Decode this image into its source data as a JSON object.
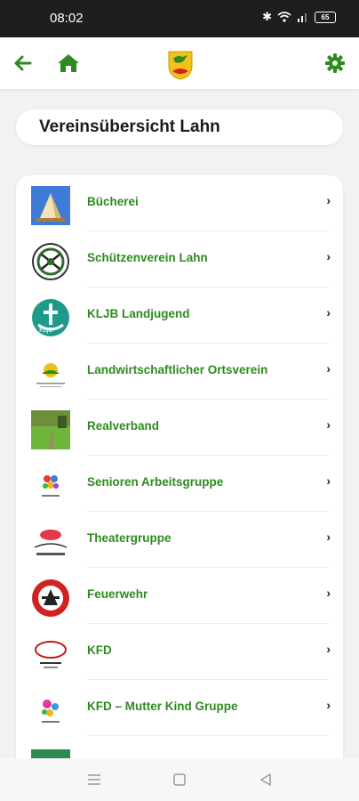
{
  "status_bar": {
    "time": "08:02",
    "battery": "65"
  },
  "app_bar": {
    "back_icon": "arrow-left-icon",
    "home_icon": "home-icon",
    "logo": "coat-of-arms-logo",
    "settings_icon": "gear-icon",
    "accent_color": "#2e8b1f"
  },
  "page": {
    "title": "Vereinsübersicht Lahn"
  },
  "clubs": [
    {
      "label": "Bücherei",
      "icon": "library-image"
    },
    {
      "label": "Schützenverein Lahn",
      "icon": "shooting-club-logo"
    },
    {
      "label": "KLJB Landjugend",
      "icon": "kljb-logo"
    },
    {
      "label": "Landwirtschaftlicher Ortsverein",
      "icon": "agriculture-logo"
    },
    {
      "label": "Realverband",
      "icon": "field-image"
    },
    {
      "label": "Senioren Arbeitsgruppe",
      "icon": "seniors-logo"
    },
    {
      "label": "Theatergruppe",
      "icon": "theater-logo"
    },
    {
      "label": "Feuerwehr",
      "icon": "fire-brigade-logo"
    },
    {
      "label": "KFD",
      "icon": "kfd-logo"
    },
    {
      "label": "KFD – Mutter Kind Gruppe",
      "icon": "mother-child-logo"
    }
  ],
  "nav_bar": {
    "menu_icon": "menu-icon",
    "home_icon": "square-icon",
    "back_icon": "triangle-back-icon"
  }
}
